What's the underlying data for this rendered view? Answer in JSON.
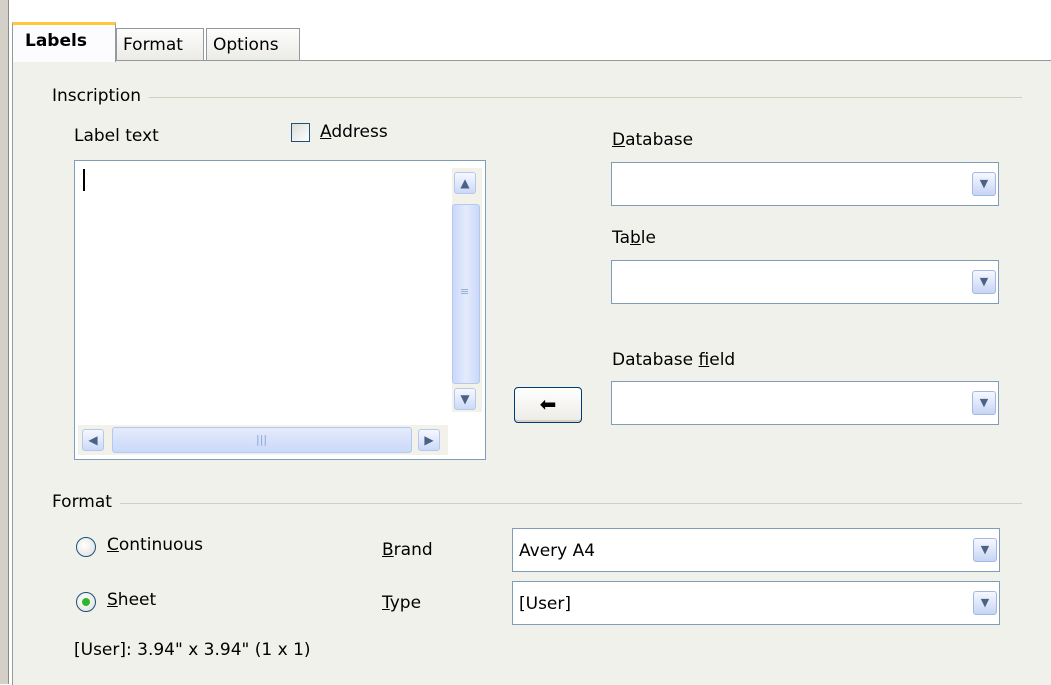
{
  "tabs": [
    {
      "label": "Labels",
      "active": true
    },
    {
      "label": "Format",
      "active": false
    },
    {
      "label": "Options",
      "active": false
    }
  ],
  "inscription": {
    "group_label": "Inscription",
    "label_text_caption": "Label text",
    "address_checkbox": {
      "label_underlined": "A",
      "label_rest": "ddress",
      "checked": false
    },
    "label_text_value": ""
  },
  "database": {
    "label_underlined": "D",
    "label_rest": "atabase",
    "value": ""
  },
  "table": {
    "label_prefix": "Ta",
    "label_underlined": "b",
    "label_rest": "le",
    "value": ""
  },
  "database_field": {
    "label_prefix": "Database ",
    "label_underlined": "f",
    "label_rest": "ield",
    "value": ""
  },
  "insert_button_icon": "left-arrow-icon",
  "format": {
    "group_label": "Format",
    "continuous": {
      "label_underlined": "C",
      "label_rest": "ontinuous",
      "selected": false
    },
    "sheet": {
      "label_underlined": "S",
      "label_rest": "heet",
      "selected": true
    },
    "brand": {
      "label_underlined": "B",
      "label_rest": "rand",
      "value": "Avery A4"
    },
    "type": {
      "label_underlined": "T",
      "label_rest": "ype",
      "value": "[User]"
    },
    "info": "[User]: 3.94\" x 3.94\" (1 x 1)"
  },
  "colors": {
    "accent_tab": "#ffc83c",
    "radio_dot": "#2cb62c",
    "field_border": "#7f9db9"
  }
}
